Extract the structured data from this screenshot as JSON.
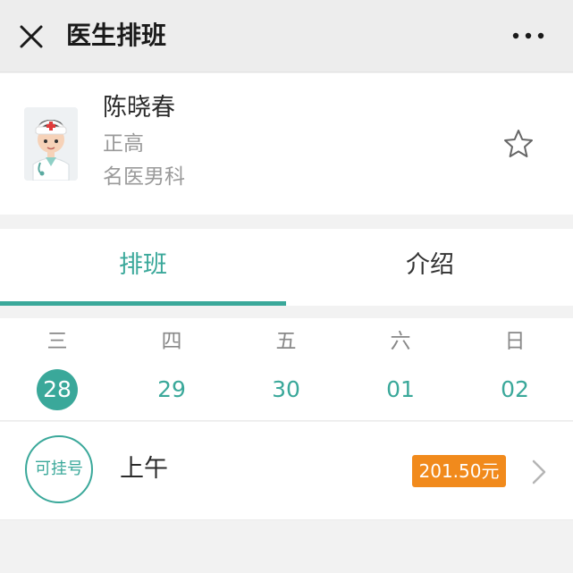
{
  "header": {
    "title": "医生排班",
    "close_icon": "close-icon",
    "more_icon": "more-icon"
  },
  "doctor": {
    "name": "陈晓春",
    "title": "正高",
    "department": "名医男科",
    "favorite_icon": "star-icon"
  },
  "tabs": [
    {
      "label": "排班",
      "active": true
    },
    {
      "label": "介绍",
      "active": false
    }
  ],
  "week": [
    {
      "weekday": "三",
      "date": "28",
      "selected": true
    },
    {
      "weekday": "四",
      "date": "29",
      "selected": false
    },
    {
      "weekday": "五",
      "date": "30",
      "selected": false
    },
    {
      "weekday": "六",
      "date": "01",
      "selected": false
    },
    {
      "weekday": "日",
      "date": "02",
      "selected": false
    }
  ],
  "slot": {
    "status": "可挂号",
    "period": "上午",
    "price": "201.50元"
  },
  "colors": {
    "accent": "#3aa89a",
    "price_badge": "#f18a1c",
    "header_bg": "#ededed",
    "page_bg": "#f2f2f2"
  }
}
